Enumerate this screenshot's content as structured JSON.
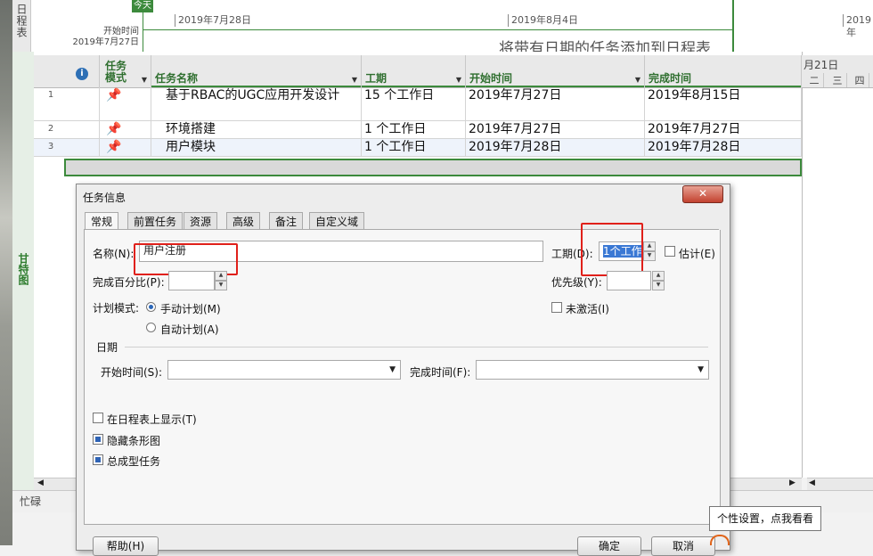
{
  "timeline": {
    "label": "日程表",
    "today_badge": "今天",
    "start_label": "开始时间",
    "start_date": "2019年7月27日",
    "ticks": [
      "2019年7月28日",
      "2019年8月4日",
      "2019年"
    ],
    "hint": "将带有日期的任务添加到日程表"
  },
  "view_label": "甘特图",
  "columns": {
    "info": "i",
    "mode_line1": "任务",
    "mode_line2": "模式",
    "name": "任务名称",
    "duration": "工期",
    "start": "开始时间",
    "finish": "完成时间"
  },
  "calendar": {
    "header": "月21日",
    "days": [
      "二",
      "三",
      "四"
    ]
  },
  "rows": [
    {
      "num": "1",
      "name": "基于RBAC的UGC应用开发设计",
      "duration": "15 个工作日",
      "start": "2019年7月27日",
      "finish": "2019年8月15日"
    },
    {
      "num": "2",
      "name": "环境搭建",
      "duration": "1 个工作日",
      "start": "2019年7月27日",
      "finish": "2019年7月27日"
    },
    {
      "num": "3",
      "name": "用户模块",
      "duration": "1 个工作日",
      "start": "2019年7月28日",
      "finish": "2019年7月28日"
    }
  ],
  "status_bar": {
    "busy": "忙碌"
  },
  "dialog": {
    "title": "任务信息",
    "close": "✕",
    "tabs": [
      "常规",
      "前置任务",
      "资源",
      "高级",
      "备注",
      "自定义域"
    ],
    "name_label": "名称(N):",
    "name_value": "用户注册",
    "duration_label": "工期(D):",
    "duration_value": "1个工作",
    "estimated_label": "估计(E)",
    "percent_label": "完成百分比(P):",
    "priority_label": "优先级(Y):",
    "mode_label": "计划模式:",
    "mode_manual": "手动计划(M)",
    "mode_auto": "自动计划(A)",
    "inactive_label": "未激活(I)",
    "dates_label": "日期",
    "start_label": "开始时间(S):",
    "finish_label": "完成时间(F):",
    "show_timeline": "在日程表上显示(T)",
    "hide_bar": "隐藏条形图",
    "summary_task": "总成型任务",
    "help_button": "帮助(H)",
    "ok_button": "确定",
    "cancel_button": "取消"
  },
  "tooltip": "个性设置，点我看看",
  "colors": {
    "accent_green": "#3c8a3c",
    "highlight_red": "#e0201a",
    "pin_teal": "#2a9aa0"
  }
}
